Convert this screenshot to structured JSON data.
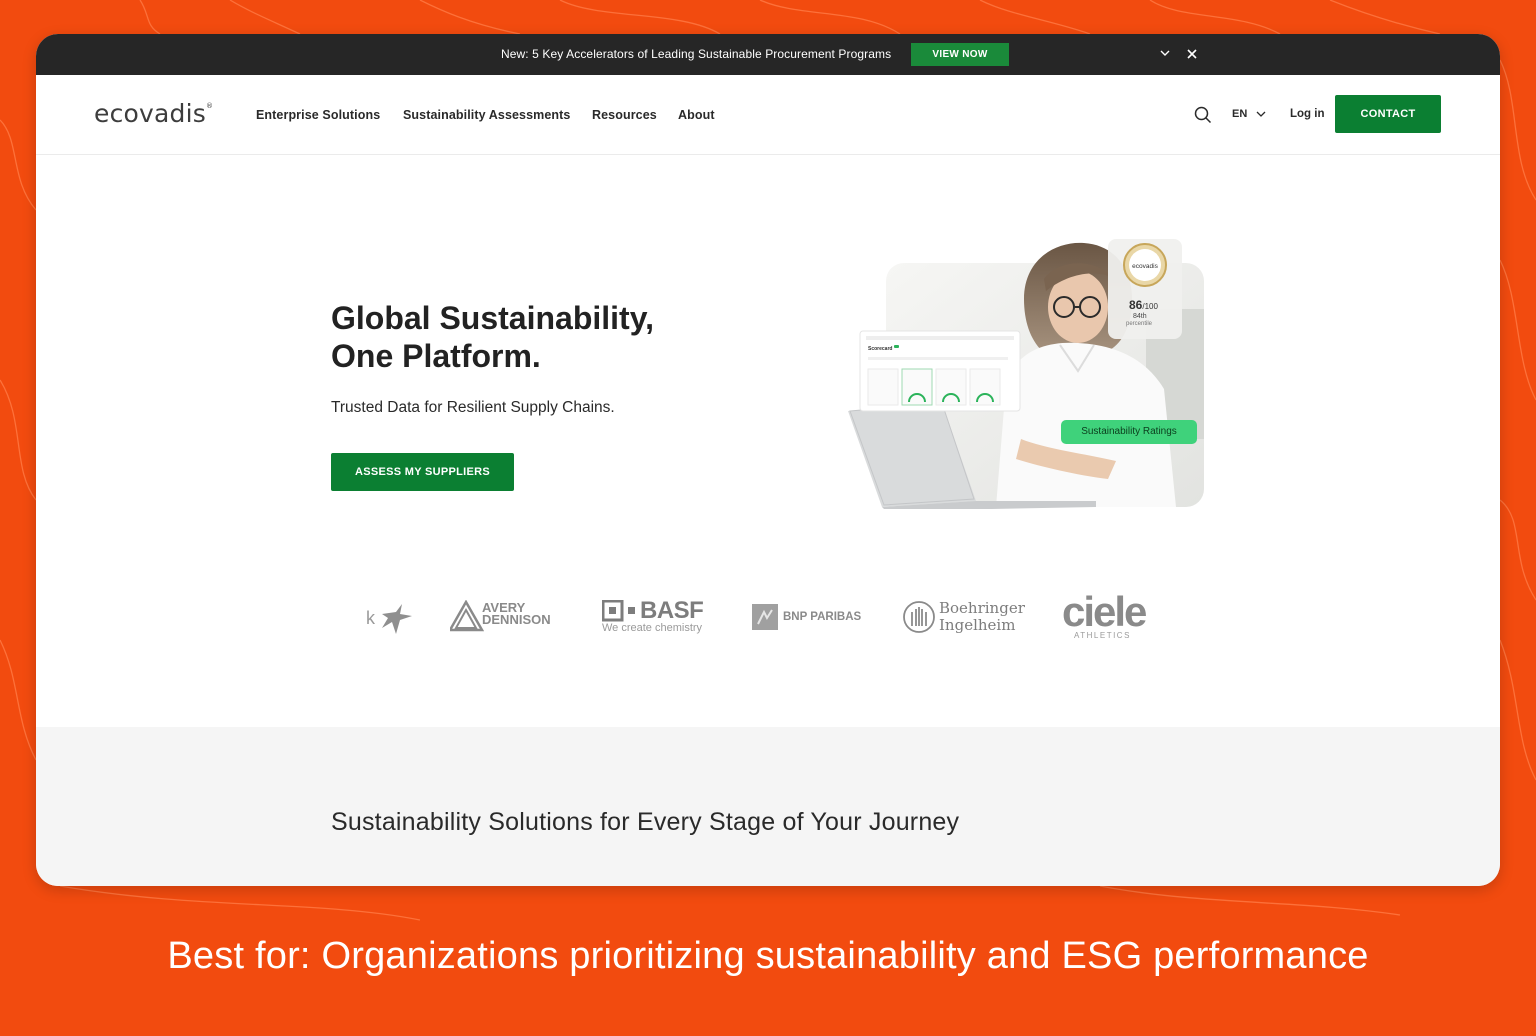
{
  "announcement": {
    "text": "New: 5 Key Accelerators of Leading Sustainable Procurement Programs",
    "cta": "VIEW NOW"
  },
  "header": {
    "logo": "ecovadis",
    "nav": [
      "Enterprise Solutions",
      "Sustainability Assessments",
      "Resources",
      "About"
    ],
    "language": "EN",
    "login": "Log in",
    "contact": "CONTACT"
  },
  "hero": {
    "title_line1": "Global Sustainability,",
    "title_line2": "One Platform.",
    "subtitle": "Trusted Data for Resilient Supply Chains.",
    "cta": "ASSESS MY SUPPLIERS",
    "badge_logo": "ecovadis",
    "score": "86",
    "score_max": "/100",
    "percentile": "84th",
    "percentile_label": "percentile",
    "pill": "Sustainability Ratings",
    "dash_title": "Scorecard"
  },
  "partner_logos": {
    "avery_1": "AVERY",
    "avery_2": "DENNISON",
    "basf": "BASF",
    "basf_tagline": "We create chemistry",
    "bnp": "BNP PARIBAS",
    "boehringer_1": "Boehringer",
    "boehringer_2": "Ingelheim",
    "ciele": "ciele",
    "ciele_sub": "ATHLETICS"
  },
  "solutions": {
    "title": "Sustainability Solutions for Every Stage of Your Journey"
  },
  "caption": {
    "lead": "Best for:",
    "text": " Organizations prioritizing sustainability and ESG performance"
  },
  "colors": {
    "background": "#f24b0f",
    "brand_green": "#0b7f32",
    "announce_bar": "#262626",
    "pill_green": "#3fd27b"
  }
}
